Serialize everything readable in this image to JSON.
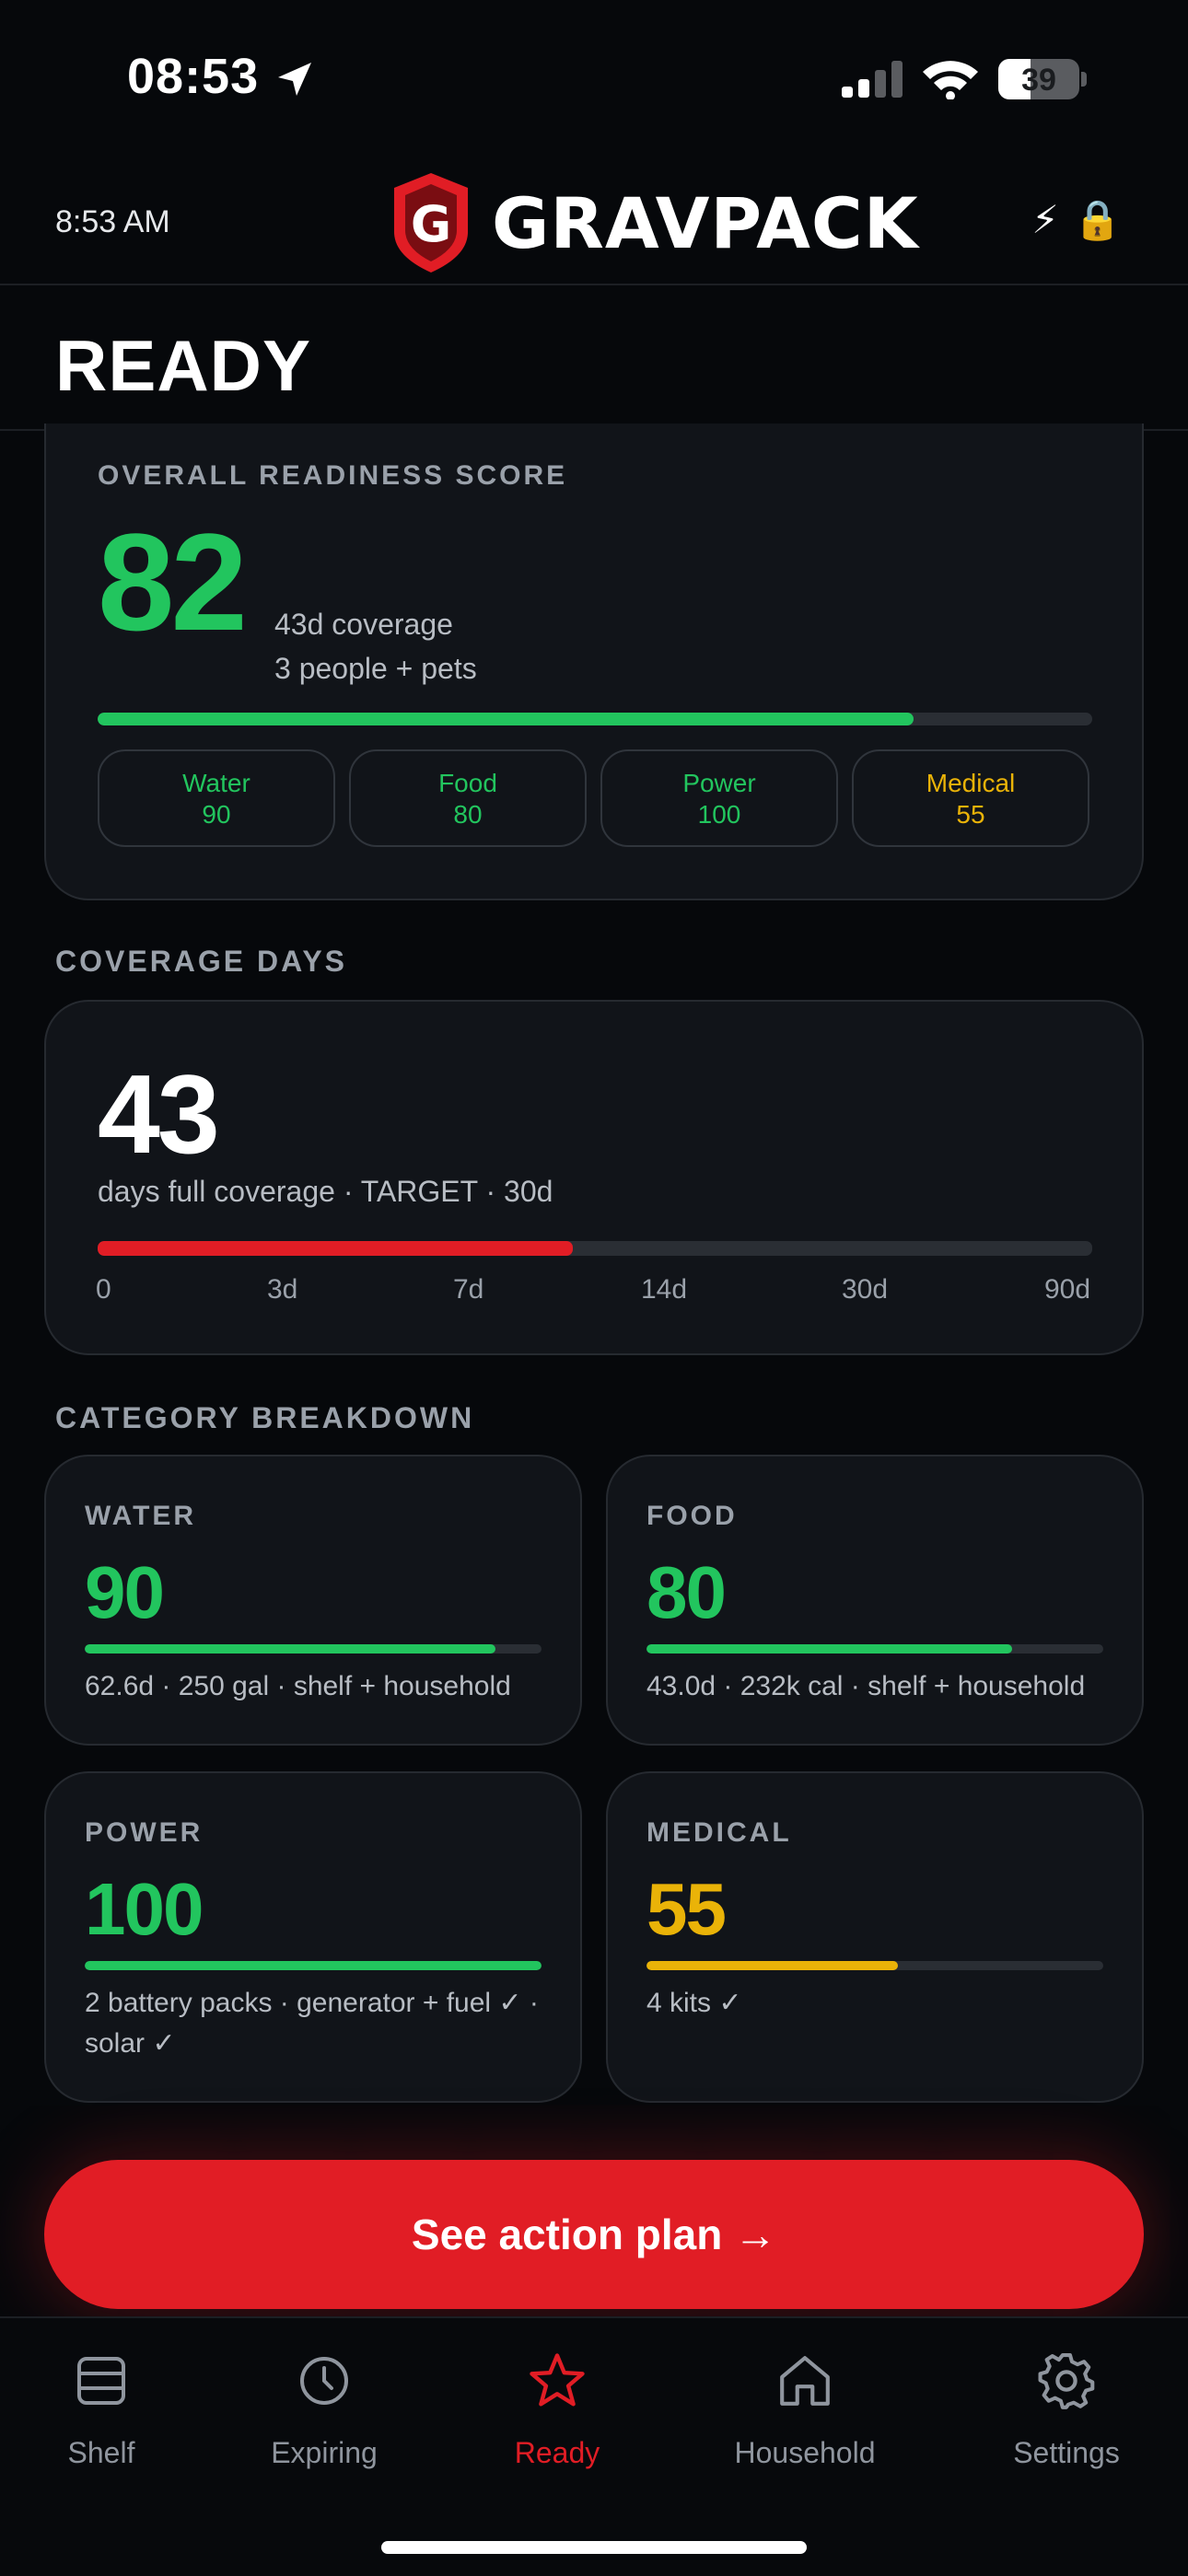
{
  "status_bar": {
    "time": "08:53",
    "battery": "39"
  },
  "app_header": {
    "time": "8:53 AM",
    "brand": "GRAVPACK",
    "logo_letter": "G",
    "icons": [
      "lightning-icon",
      "lock-icon"
    ]
  },
  "page": {
    "title": "READY"
  },
  "readiness": {
    "label": "OVERALL READINESS SCORE",
    "score": "82",
    "coverage": "43d coverage",
    "people": "3 people + pets",
    "progress": 0.82,
    "pills": [
      {
        "name": "Water",
        "value": "90",
        "color": "#22c55e"
      },
      {
        "name": "Food",
        "value": "80",
        "color": "#22c55e"
      },
      {
        "name": "Power",
        "value": "100",
        "color": "#22c55e"
      },
      {
        "name": "Medical",
        "value": "55",
        "color": "#eab308"
      }
    ]
  },
  "coverage": {
    "section_label": "COVERAGE DAYS",
    "days": "43",
    "caption": "days full coverage · TARGET · 30d",
    "progress": 0.478,
    "ticks": [
      "0",
      "3d",
      "7d",
      "14d",
      "30d",
      "90d"
    ]
  },
  "breakdown": {
    "section_label": "CATEGORY BREAKDOWN",
    "categories": [
      {
        "label": "WATER",
        "score": "90",
        "progress": 0.9,
        "color": "#22c55e",
        "desc": "62.6d · 250 gal · shelf + household"
      },
      {
        "label": "FOOD",
        "score": "80",
        "progress": 0.8,
        "color": "#22c55e",
        "desc": "43.0d · 232k cal · shelf + household"
      },
      {
        "label": "POWER",
        "score": "100",
        "progress": 1.0,
        "color": "#22c55e",
        "desc": "2 battery packs · generator + fuel ✓ · solar ✓"
      },
      {
        "label": "MEDICAL",
        "score": "55",
        "progress": 0.55,
        "color": "#eab308",
        "desc": "4 kits ✓"
      }
    ]
  },
  "cta": {
    "label": "See action plan →"
  },
  "tabs": [
    {
      "label": "Shelf",
      "icon": "shelf-icon"
    },
    {
      "label": "Expiring",
      "icon": "clock-icon"
    },
    {
      "label": "Ready",
      "icon": "star-icon",
      "active": true
    },
    {
      "label": "Household",
      "icon": "house-icon"
    },
    {
      "label": "Settings",
      "icon": "gear-icon"
    }
  ],
  "colors": {
    "accent": "#e11d25",
    "good": "#22c55e",
    "warn": "#eab308"
  }
}
